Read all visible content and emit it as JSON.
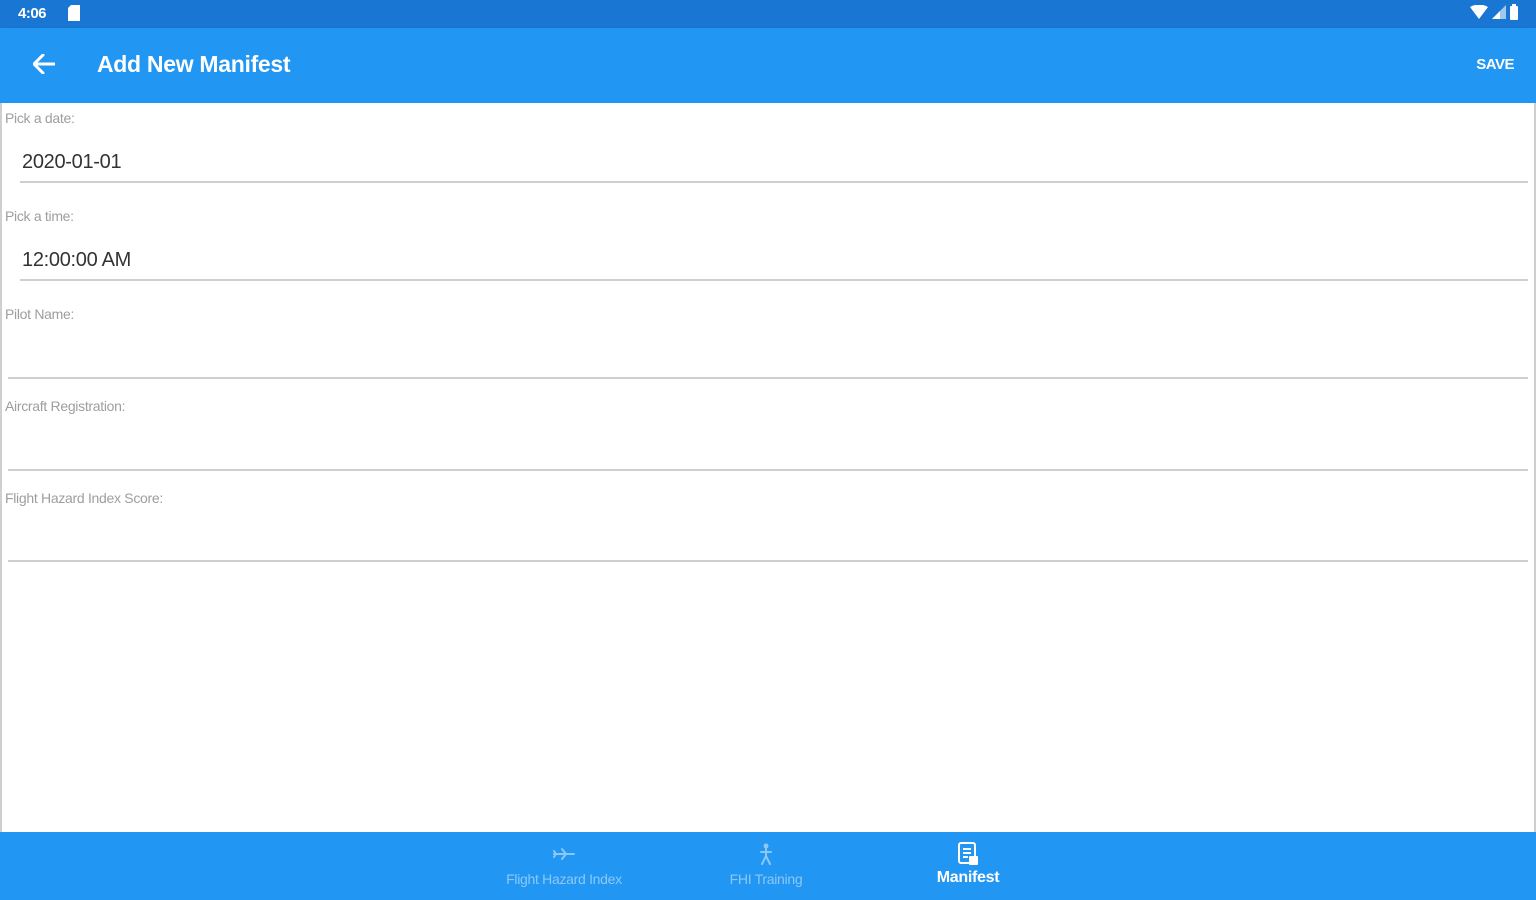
{
  "status_bar": {
    "time": "4:06",
    "icons": [
      "sd-card-icon",
      "wifi-icon",
      "cell-signal-icon",
      "battery-icon"
    ]
  },
  "app_bar": {
    "title": "Add New Manifest",
    "back_icon": "arrow-back-icon",
    "save_label": "SAVE"
  },
  "form": {
    "date": {
      "label": "Pick a date:",
      "value": "2020-01-01"
    },
    "time": {
      "label": "Pick a time:",
      "value": "12:00:00 AM"
    },
    "pilot_name": {
      "label": "Pilot Name:",
      "value": ""
    },
    "aircraft_registration": {
      "label": "Aircraft Registration:",
      "value": ""
    },
    "fhi_score": {
      "label": "Flight Hazard Index Score:",
      "value": ""
    }
  },
  "bottom_nav": {
    "items": [
      {
        "label": "Flight Hazard Index",
        "icon": "airplane-icon",
        "active": false
      },
      {
        "label": "FHI Training",
        "icon": "person-icon",
        "active": false
      },
      {
        "label": "Manifest",
        "icon": "document-icon",
        "active": true
      }
    ]
  },
  "colors": {
    "status_bar": "#1976d2",
    "app_bar": "#2196f3",
    "bottom_nav": "#2196f3",
    "nav_inactive": "#8cc8f7",
    "nav_active": "#ffffff"
  }
}
